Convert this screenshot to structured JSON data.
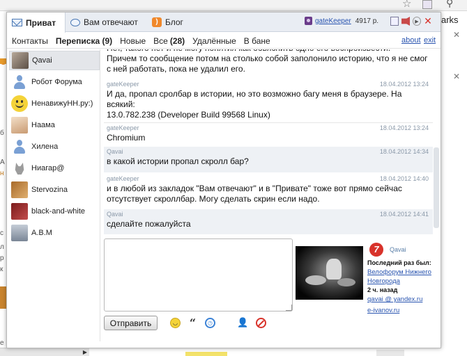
{
  "browser": {
    "bookmarks_fragment": "arks",
    "left_edge_chars": [
      "о",
      "б",
      "А",
      "н",
      "с",
      "л",
      "р",
      "к",
      "е"
    ]
  },
  "tabs": [
    {
      "label": "Приват",
      "icon": "envelope-icon",
      "active": true
    },
    {
      "label": "Вам отвечают",
      "icon": "speech-bubble-icon",
      "active": false
    },
    {
      "label": "Блог",
      "icon": "rss-icon",
      "active": false
    }
  ],
  "user": {
    "name": "gateKeeper",
    "points": "4917 р."
  },
  "subnav": {
    "items": [
      "Контакты",
      "Переписка (9)",
      "Новые",
      "Все",
      "(28)",
      "Удалённые",
      "В бане"
    ],
    "about": "about",
    "exit": "exit"
  },
  "contacts": [
    {
      "name": "Qavai",
      "avatar": "photo"
    },
    {
      "name": "Робот Форума",
      "avatar": "person"
    },
    {
      "name": "НенавижуНН.ру:)",
      "avatar": "smile"
    },
    {
      "name": "Наама",
      "avatar": "face"
    },
    {
      "name": "Хилена",
      "avatar": "person"
    },
    {
      "name": "Ниагар@",
      "avatar": "cat"
    },
    {
      "name": "Stervozina",
      "avatar": "anim"
    },
    {
      "name": "black-and-white",
      "avatar": "maroon"
    },
    {
      "name": "A.B.M",
      "avatar": "abm"
    }
  ],
  "messages": [
    {
      "author": "",
      "date": "",
      "text": "Нет, такого нет и не могу понятия как обьяснить одно его воспроизвести.\nПричем то сообщение потом на столько собой заполонило историю, что я не смог с ней работать, пока не удалил его."
    },
    {
      "author": "gateKeeper",
      "date": "18.04.2012 13:24",
      "text": "И да, пропал сролбар в истории, но это возможно багу меня в браузере. На всякий:\n13.0.782.238 (Developer Build 99568 Linux)"
    },
    {
      "author": "gateKeeper",
      "date": "18.04.2012 13:24",
      "text": "Chromium"
    },
    {
      "author": "Qavai",
      "date": "18.04.2012 14:34",
      "text": "в какой истории пропал скролл бар?"
    },
    {
      "author": "gateKeeper",
      "date": "18.04.2012 14:40",
      "text": "и в любой из закладок \"Вам отвечают\" и в \"Привате\" тоже вот прямо сейчас отсутствует скроллбар. Могу сделать скрин если надо."
    },
    {
      "author": "Qavai",
      "date": "18.04.2012 14:41",
      "text": "сделайте пожалуйста"
    }
  ],
  "compose": {
    "value": "",
    "send_label": "Отправить"
  },
  "profile": {
    "badge": "7",
    "name": "Qavai",
    "last_seen_label": "Последний раз был:",
    "forum_line1": "Велофорум Нижнего",
    "forum_line2": "Новгорода",
    "ago": "2 ч. назад",
    "email": "qavai @ yandex.ru",
    "site": "e-ivanov.ru"
  }
}
